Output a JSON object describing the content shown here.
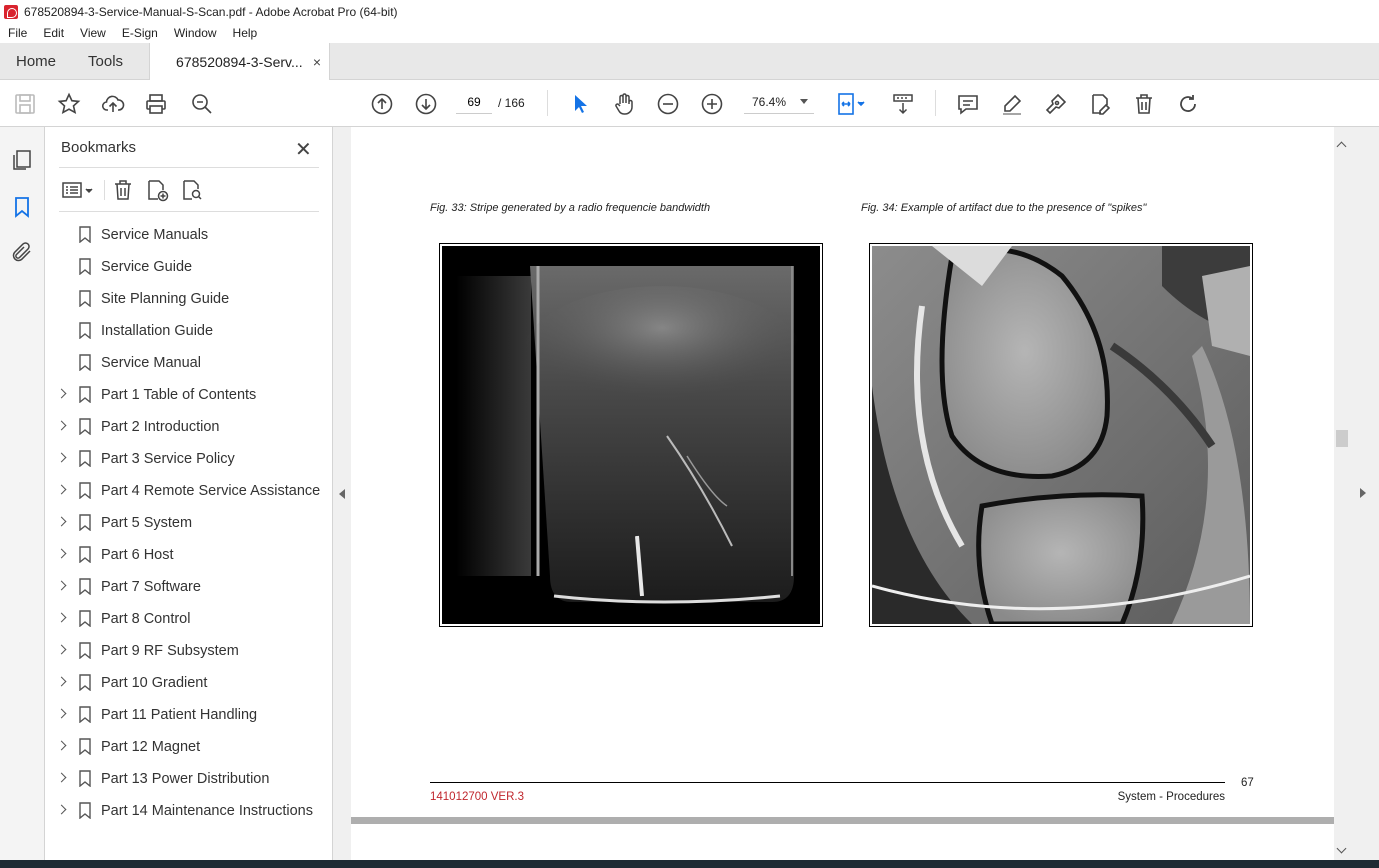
{
  "window": {
    "title": "678520894-3-Service-Manual-S-Scan.pdf - Adobe Acrobat Pro (64-bit)"
  },
  "menu": [
    "File",
    "Edit",
    "View",
    "E-Sign",
    "Window",
    "Help"
  ],
  "tabs": {
    "home": "Home",
    "tools": "Tools",
    "document": "678520894-3-Serv...",
    "close": "×"
  },
  "toolbar": {
    "page_current": "69",
    "page_total": "/ 166",
    "zoom": "76.4%"
  },
  "bookmarks": {
    "title": "Bookmarks",
    "close": "✕",
    "items": [
      {
        "label": "Service Manuals",
        "expandable": false
      },
      {
        "label": "Service Guide",
        "expandable": false
      },
      {
        "label": "Site Planning Guide",
        "expandable": false
      },
      {
        "label": "Installation Guide",
        "expandable": false
      },
      {
        "label": "Service Manual",
        "expandable": false
      },
      {
        "label": "Part 1 Table of Contents",
        "expandable": true
      },
      {
        "label": "Part 2 Introduction",
        "expandable": true
      },
      {
        "label": "Part 3 Service Policy",
        "expandable": true
      },
      {
        "label": "Part 4 Remote Service Assistance",
        "expandable": true
      },
      {
        "label": "Part 5 System",
        "expandable": true
      },
      {
        "label": "Part 6 Host",
        "expandable": true
      },
      {
        "label": "Part 7 Software",
        "expandable": true
      },
      {
        "label": "Part 8 Control",
        "expandable": true
      },
      {
        "label": "Part 9 RF Subsystem",
        "expandable": true
      },
      {
        "label": "Part 10 Gradient",
        "expandable": true
      },
      {
        "label": "Part 11 Patient Handling",
        "expandable": true
      },
      {
        "label": "Part 12 Magnet",
        "expandable": true
      },
      {
        "label": "Part 13 Power Distribution",
        "expandable": true
      },
      {
        "label": "Part 14 Maintenance Instructions",
        "expandable": true
      }
    ]
  },
  "page": {
    "fig33_caption": "Fig. 33:   Stripe generated by a radio frequencie bandwidth",
    "fig34_caption": "Fig. 34:   Example of artifact due to the presence of \"spikes\"",
    "page_number": "67",
    "version": "141012700 VER.3",
    "section": "System - Procedures"
  },
  "colors": {
    "accent_red": "#c0262d",
    "select_blue": "#1473e6"
  }
}
